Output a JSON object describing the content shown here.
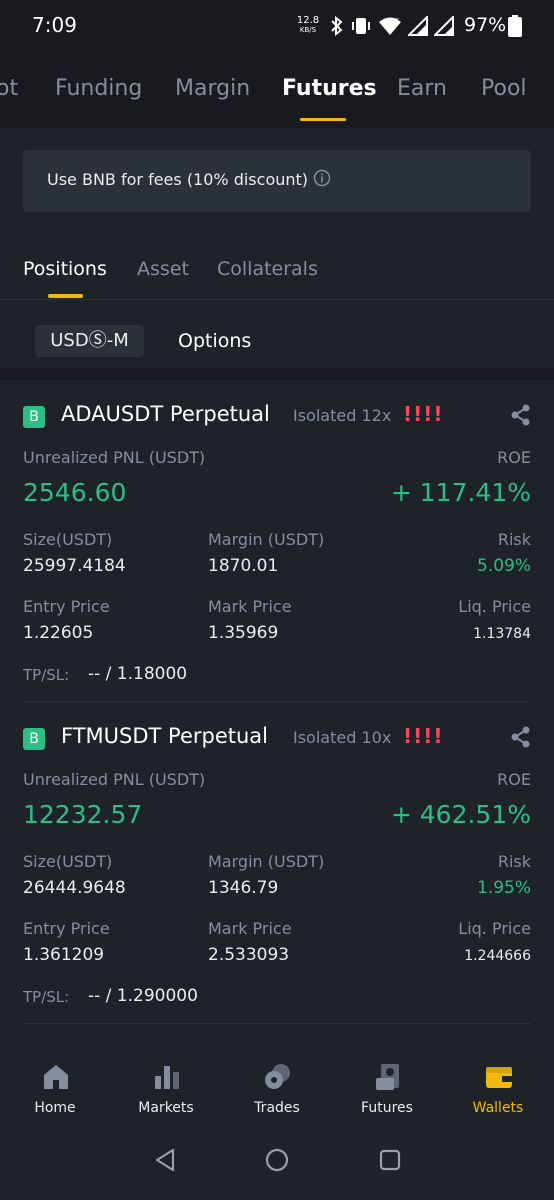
{
  "status": {
    "time": "7:09",
    "net_speed": "12.8",
    "net_unit": "KB/S",
    "battery": "97%"
  },
  "top_tabs": [
    "ot",
    "Funding",
    "Margin",
    "Futures",
    "Earn",
    "Pool"
  ],
  "active_top_tab": "Futures",
  "banner": {
    "text": "Use BNB for fees (10% discount)"
  },
  "sub_tabs": [
    "Positions",
    "Asset",
    "Collaterals"
  ],
  "margin_types": {
    "selected": "USDⓈ-M",
    "other": "Options"
  },
  "labels": {
    "unrealized_pnl": "Unrealized PNL (USDT)",
    "roe": "ROE",
    "size": "Size(USDT)",
    "margin": "Margin (USDT)",
    "risk": "Risk",
    "entry_price": "Entry Price",
    "mark_price": "Mark Price",
    "liq_price": "Liq. Price",
    "tpsl": "TP/SL:"
  },
  "positions": [
    {
      "badge": "B",
      "symbol": "ADAUSDT Perpetual",
      "mode": "Isolated 12x",
      "risk_mark": "!!!!",
      "pnl": "2546.60",
      "roe": "+ 117.41%",
      "size": "25997.4184",
      "margin": "1870.01",
      "risk": "5.09%",
      "entry_price": "1.22605",
      "mark_price": "1.35969",
      "liq_price": "1.13784",
      "tpsl": "-- / 1.18000"
    },
    {
      "badge": "B",
      "symbol": "FTMUSDT Perpetual",
      "mode": "Isolated 10x",
      "risk_mark": "!!!!",
      "pnl": "12232.57",
      "roe": "+ 462.51%",
      "size": "26444.9648",
      "margin": "1346.79",
      "risk": "1.95%",
      "entry_price": "1.361209",
      "mark_price": "2.533093",
      "liq_price": "1.244666",
      "tpsl": "-- / 1.290000"
    }
  ],
  "bottom_nav": [
    {
      "label": "Home",
      "icon": "home-icon"
    },
    {
      "label": "Markets",
      "icon": "markets-icon"
    },
    {
      "label": "Trades",
      "icon": "trades-icon"
    },
    {
      "label": "Futures",
      "icon": "futures-icon"
    },
    {
      "label": "Wallets",
      "icon": "wallet-icon"
    }
  ],
  "active_bottom_nav": "Wallets",
  "colors": {
    "accent": "#f0b90b",
    "positive": "#2ebd85",
    "warning": "#f6465d",
    "muted": "#848e9c"
  }
}
